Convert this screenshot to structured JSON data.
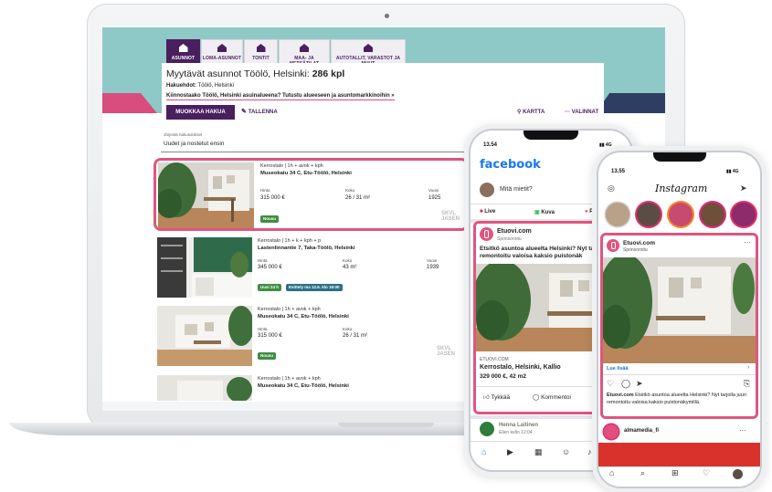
{
  "listing_site": {
    "tabs": [
      {
        "label": "ASUNNOT",
        "active": true
      },
      {
        "label": "LOMA-ASUNNOT"
      },
      {
        "label": "TONTIT"
      },
      {
        "label": "MAA- JA METSÄTILAT"
      },
      {
        "label": "AUTOTALLIT, VARASTOT JA MUUT"
      }
    ],
    "title_prefix": "Myytävät asunnot Töölö, Helsinki: ",
    "title_count": "286 kpl",
    "criteria_label": "Hakuehdot:",
    "criteria_value": " Töölö, Helsinki",
    "region_link": "Kiinnostaako Töölö, Helsinki asuinalueena? Tutustu alueeseen ja asuntomarkkinoihin »",
    "edit_search": "MUOKKAA HAKUA",
    "save_label": "TALLENNA",
    "map_label": "KARTTA",
    "filters_label": "VALINNAT",
    "sort_label": "Järjestä hakutulokset",
    "sort_value": "Uudet ja nostetut ensin",
    "col_price": "Hinta",
    "col_size": "Koko",
    "col_year": "Vuosi",
    "listings": [
      {
        "type": "Kerrostalo | 1h + avok + kph",
        "address": "Museokatu 34 C, Etu-Töölö, Helsinki",
        "price": "315 000 €",
        "size": "26 / 31 m²",
        "year": "1925",
        "badges": [
          "Nousu"
        ],
        "watermark": "SKVL\nJÄSEN"
      },
      {
        "type": "Kerrostalo | 1h + k + kph + p",
        "address": "Lastenlinnantie 7, Taka-Töölö, Helsinki",
        "price": "345 000 €",
        "size": "43 m²",
        "year": "1939",
        "badges": [
          "Uusi 24 h",
          "Esittely ma 12.6. klo 16:00"
        ]
      },
      {
        "type": "Kerrostalo | 1h + avok + kph",
        "address": "Museokatu 34 C, Etu-Töölö, Helsinki",
        "price": "315 000 €",
        "size": "26 / 31 m²",
        "year": "1925",
        "badges": [
          "Nousu"
        ],
        "watermark": "SKVL\nJÄSEN"
      },
      {
        "type": "Kerrostalo | 1h + avok + kph",
        "address": "Museokatu 34 C, Etu-Töölö, Helsinki"
      }
    ]
  },
  "facebook": {
    "time": "13.54",
    "signal": "4G",
    "logo": "facebook",
    "composer": "Mitä mietit?",
    "live": "Live",
    "photo": "Kuva",
    "place": "Pa",
    "page_name": "Etuovi.com",
    "sponsored": "Sponsoroitu · ",
    "ad_text": "Etsitkö asuntoa alueelta Helsinki? Nyt tar juuri remontoitu valoisa kaksio puistonäk",
    "link_domain": "ETUOVI.COM",
    "link_title": "Kerrostalo, Helsinki, Kallio",
    "link_desc": "329 000 €, 42 m2",
    "cta": "L",
    "like": "Tykkää",
    "comment": "Kommentoi",
    "next_user": "Henna Laitinen",
    "next_meta": "Eilen kello 12:04 · "
  },
  "instagram": {
    "time": "13.55",
    "signal": "4G",
    "logo": "Instagram",
    "page_name": "Etuovi.com",
    "sponsored": "Sponsoroitu",
    "cta": "Lue lisää",
    "caption_user": "Etuovi.com",
    "caption_text": " Etsitkö asuntoa alueelta Helsinki? Nyt tarjolla juuri remontoitu valoisa kaksio puistonäkymillä.",
    "next_user": "almamedia_fi"
  }
}
